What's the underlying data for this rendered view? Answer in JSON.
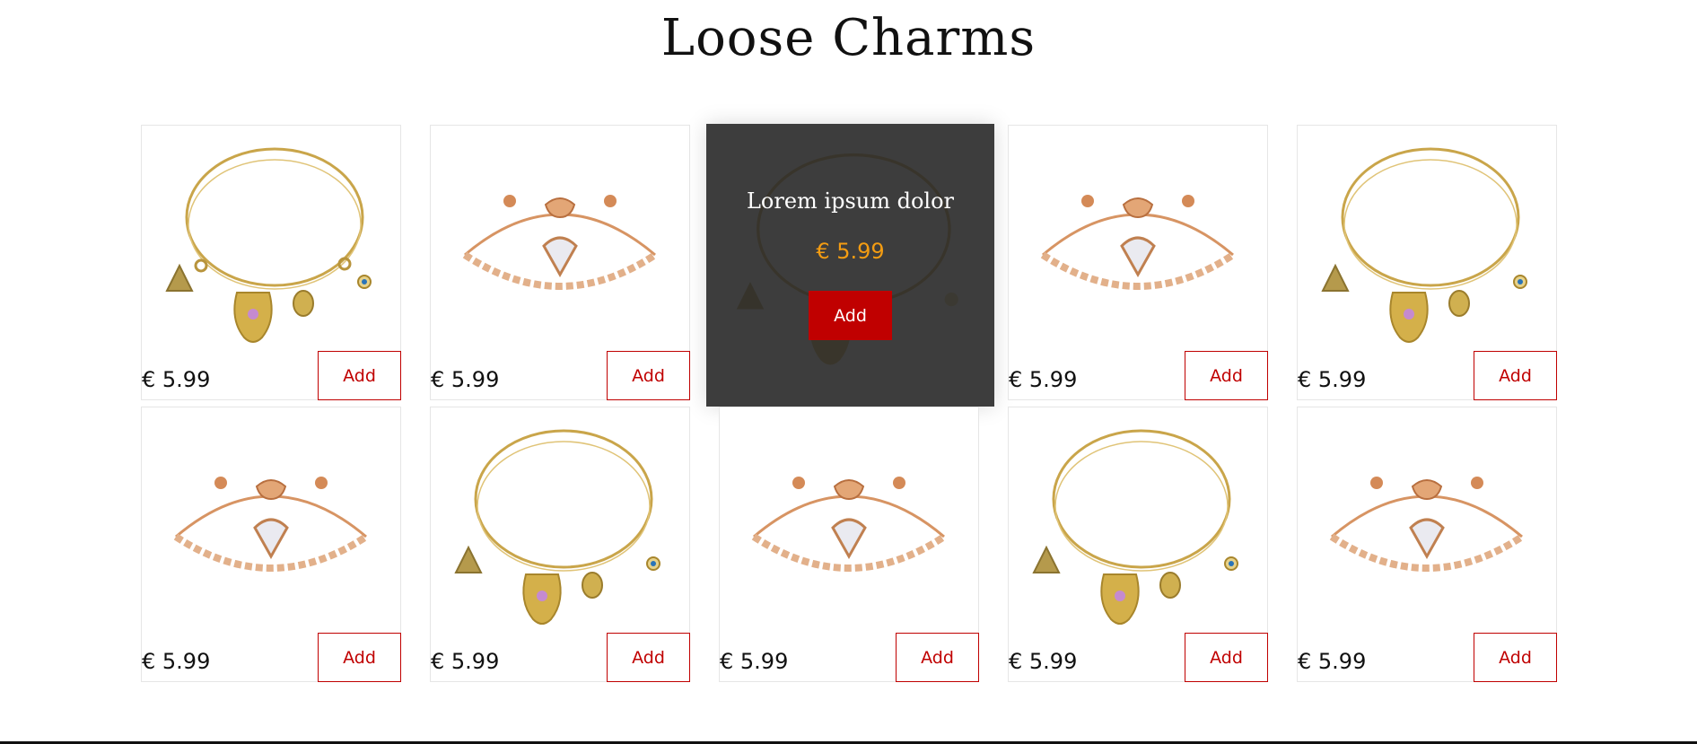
{
  "page": {
    "title": "Loose Charms"
  },
  "hover_card": {
    "name": "Lorem ipsum dolor",
    "price": "€ 5.99",
    "add_label": "Add"
  },
  "products": [
    {
      "price": "€ 5.99",
      "add_label": "Add",
      "image": "gold-charm-bangle"
    },
    {
      "price": "€ 5.99",
      "add_label": "Add",
      "image": "rose-gold-heart-bracelet"
    },
    {
      "price": "€ 5.99",
      "add_label": "Add",
      "image": "gold-charm-bangle"
    },
    {
      "price": "€ 5.99",
      "add_label": "Add",
      "image": "rose-gold-heart-bracelet"
    },
    {
      "price": "€ 5.99",
      "add_label": "Add",
      "image": "gold-charm-bangle"
    },
    {
      "price": "€ 5.99",
      "add_label": "Add",
      "image": "rose-gold-heart-bracelet"
    },
    {
      "price": "€ 5.99",
      "add_label": "Add",
      "image": "gold-charm-bangle"
    },
    {
      "price": "€ 5.99",
      "add_label": "Add",
      "image": "rose-gold-heart-bracelet"
    },
    {
      "price": "€ 5.99",
      "add_label": "Add",
      "image": "gold-charm-bangle"
    },
    {
      "price": "€ 5.99",
      "add_label": "Add",
      "image": "rose-gold-heart-bracelet"
    }
  ],
  "colors": {
    "accent": "#c00000",
    "hover_price": "#f39c12",
    "overlay": "#282828"
  }
}
